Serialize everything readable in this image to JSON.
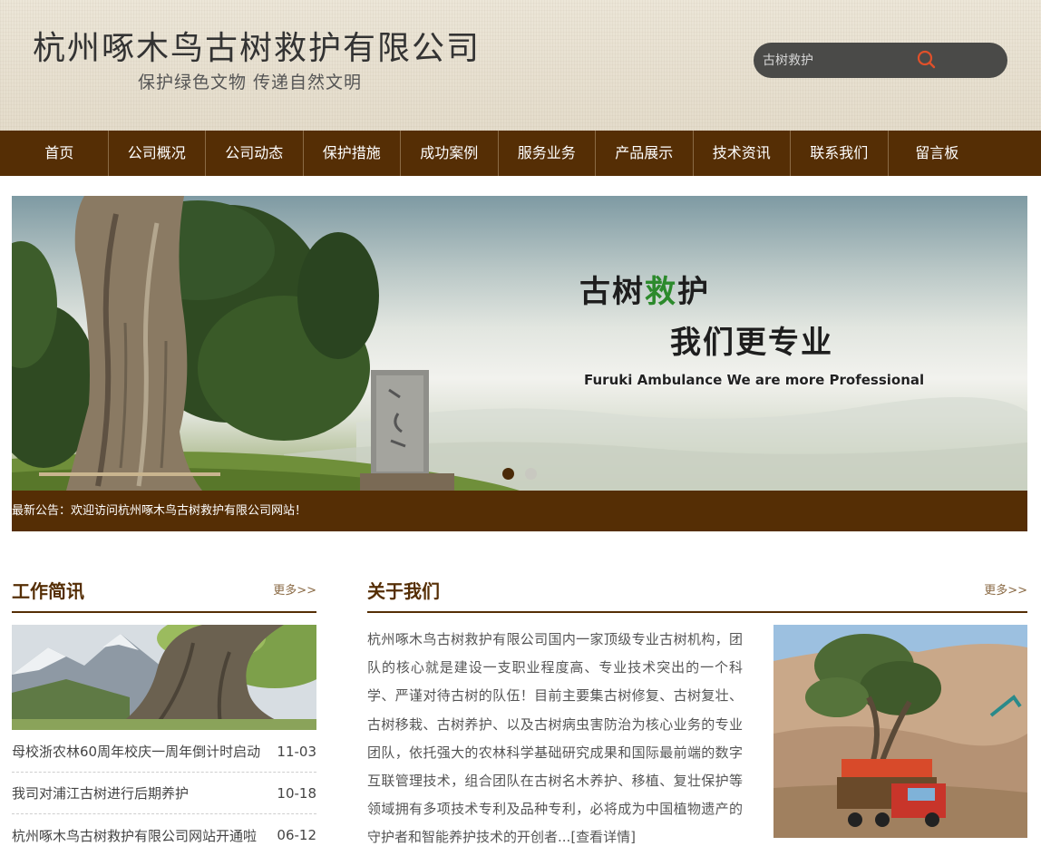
{
  "header": {
    "company_name": "杭州啄木鸟古树救护有限公司",
    "slogan": "保护绿色文物 传递自然文明",
    "search": {
      "placeholder": "古树救护",
      "icon": "search-icon"
    }
  },
  "nav": {
    "items": [
      "首页",
      "公司概况",
      "公司动态",
      "保护措施",
      "成功案例",
      "服务业务",
      "产品展示",
      "技术资讯",
      "联系我们",
      "留言板"
    ]
  },
  "banner": {
    "headline_part1": "古树",
    "headline_highlight": "救",
    "headline_part2": "护",
    "subline": "我们更专业",
    "english": "Furuki Ambulance We are more Professional",
    "slides": 2,
    "active_slide": 1
  },
  "notice": {
    "text": "最新公告：欢迎访问杭州啄木鸟古树救护有限公司网站！"
  },
  "news": {
    "title": "工作简讯",
    "more": "更多>>",
    "items": [
      {
        "title": "母校浙农林60周年校庆一周年倒计时启动",
        "date": "11-03"
      },
      {
        "title": "我司对浦江古树进行后期养护",
        "date": "10-18"
      },
      {
        "title": "杭州啄木鸟古树救护有限公司网站开通啦",
        "date": "06-12"
      }
    ]
  },
  "about": {
    "title": "关于我们",
    "more": "更多>>",
    "text": "杭州啄木鸟古树救护有限公司国内一家顶级专业古树机构，团队的核心就是建设一支职业程度高、专业技术突出的一个科学、严谨对待古树的队伍！目前主要集古树修复、古树复壮、古树移栽、古树养护、以及古树病虫害防治为核心业务的专业团队，依托强大的农林科学基础研究成果和国际最前端的数字互联管理技术，组合团队在古树名木养护、移植、复壮保护等领域拥有多项技术专利及品种专利，必将成为中国植物遗产的守护者和智能养护技术的开创者...",
    "detail_link": "[查看详情]"
  },
  "colors": {
    "brand_brown": "#552e05",
    "header_bg": "#e8e2d3",
    "search_bg": "#4a4a48",
    "search_icon": "#e0502a",
    "highlight_green": "#2c8a2c"
  }
}
